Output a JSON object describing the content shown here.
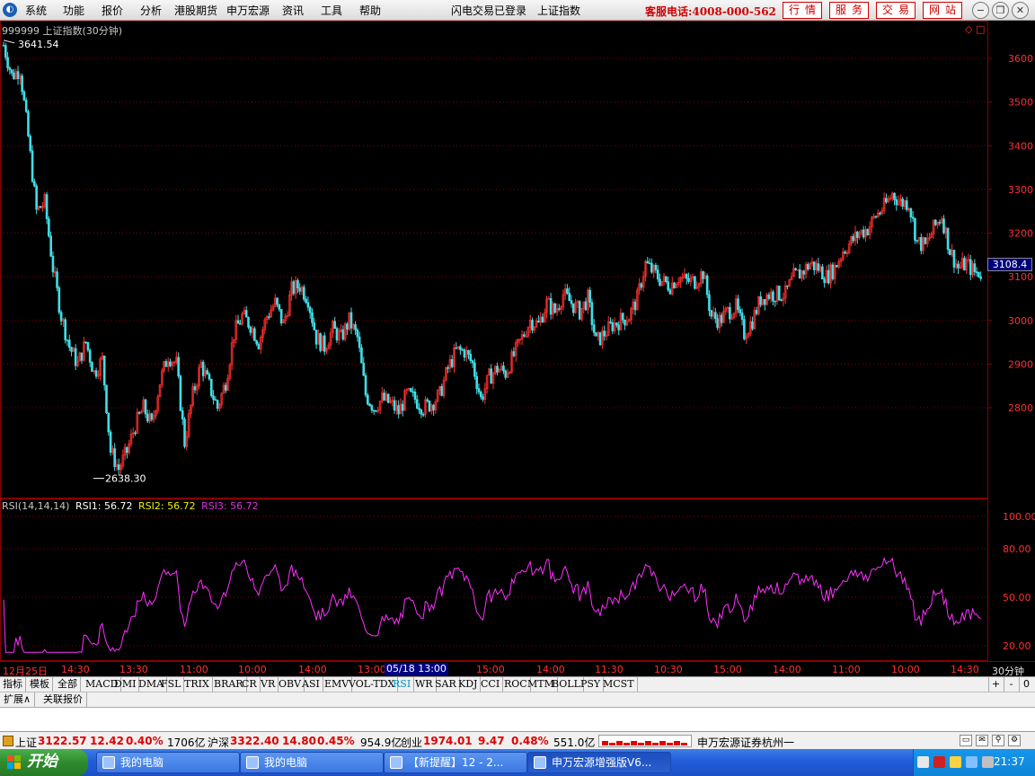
{
  "menubar": {
    "logo": "◐",
    "items": [
      "系统",
      "功能",
      "报价",
      "分析",
      "港股期货",
      "申万宏源",
      "资讯",
      "工具",
      "帮助"
    ],
    "status": "闪电交易已登录",
    "index_name": "上证指数",
    "hotline": "客服电话:4008-000-562",
    "buttons": [
      "行情",
      "服务",
      "交易",
      "网站"
    ],
    "window_buttons": [
      "−",
      "❐",
      "✕"
    ]
  },
  "chart": {
    "title": "999999 上证指数(30分钟)",
    "panel_icons": "◇ □",
    "high_marker": "3641.54",
    "low_marker": "2638.30",
    "cursor_price": "3108.4",
    "price_axis": [
      "3600",
      "3500",
      "3400",
      "3300",
      "3200",
      "3100",
      "3000",
      "2900",
      "2800"
    ],
    "rsi_axis": [
      "100.00",
      "80.00",
      "50.00",
      "20.00"
    ],
    "colors": {
      "up": "#ff3030",
      "down": "#40e0e8",
      "rsi": "#ff30ff",
      "grid": "#880000"
    }
  },
  "chart_data": [
    {
      "type": "line",
      "title": "999999 上证指数(30分钟)",
      "ylim": [
        2620,
        3680
      ],
      "high": 3641.54,
      "low": 2638.3,
      "last": 3108.4,
      "close": [
        3630,
        3560,
        3575,
        3420,
        3250,
        3270,
        3120,
        3010,
        2940,
        2900,
        2950,
        2880,
        2910,
        2700,
        2660,
        2700,
        2760,
        2800,
        2760,
        2860,
        2920,
        2900,
        2720,
        2830,
        2900,
        2850,
        2800,
        2860,
        2970,
        3010,
        2990,
        2950,
        3010,
        3040,
        2990,
        3070,
        3080,
        3050,
        2960,
        2940,
        2980,
        2960,
        3000,
        2960,
        2830,
        2800,
        2820,
        2810,
        2790,
        2830,
        2820,
        2800,
        2810,
        2830,
        2890,
        2930,
        2930,
        2900,
        2820,
        2870,
        2890,
        2880,
        2920,
        2960,
        3000,
        2990,
        3040,
        3020,
        3060,
        3040,
        3020,
        3050,
        2950,
        2970,
        2990,
        3000,
        3010,
        3050,
        3130,
        3110,
        3090,
        3080,
        3100,
        3090,
        3090,
        3110,
        3010,
        3000,
        3020,
        3030,
        2970,
        3000,
        3050,
        3060,
        3060,
        3060,
        3100,
        3110,
        3130,
        3120,
        3100,
        3120,
        3160,
        3180,
        3200,
        3210,
        3240,
        3260,
        3290,
        3270,
        3270,
        3180,
        3170,
        3210,
        3240,
        3160,
        3120,
        3130,
        3110,
        3108
      ]
    },
    {
      "type": "line",
      "title": "RSI(14,14,14)",
      "series": [
        {
          "name": "RSI1",
          "last": 56.72
        },
        {
          "name": "RSI2",
          "last": 56.72
        },
        {
          "name": "RSI3",
          "last": 56.72
        }
      ],
      "ylim": [
        20,
        100
      ]
    }
  ],
  "rsi": {
    "label": "RSI(14,14,14)",
    "rsi1": "RSI1: 56.72",
    "rsi2": "RSI2: 56.72",
    "rsi3": "RSI3: 56.72"
  },
  "timeaxis": {
    "ticks": [
      "12月25日",
      "14:30",
      "13:30",
      "11:00",
      "10:00",
      "14:00",
      "13:00",
      "15:00",
      "14:00",
      "11:30",
      "10:30",
      "15:00",
      "14:00",
      "11:00",
      "10:00",
      "14:30"
    ],
    "cursor": "05/18 13:00",
    "period": "30分钟"
  },
  "tabs": {
    "items": [
      "指标",
      "模板",
      "全部",
      "MACD",
      "DMI",
      "DMA",
      "FSL",
      "TRIX",
      "BRAR",
      "CR",
      "VR",
      "OBV",
      "ASI",
      "EMV",
      "VOL-TDX",
      "RSI",
      "WR",
      "SAR",
      "KDJ",
      "CCI",
      "ROC",
      "MTM",
      "BOLL",
      "PSY",
      "MCST"
    ],
    "active": "RSI",
    "nav": [
      "+",
      "-",
      "0"
    ]
  },
  "expand": {
    "items": [
      "扩展∧",
      "关联报价"
    ]
  },
  "status": {
    "sh_label": "上证",
    "sh_price": "3122.57",
    "sh_change": "12.42",
    "sh_pct": "0.40%",
    "sh_amount": "1706亿",
    "hs_label": "沪深",
    "hs_price": "3322.40",
    "hs_change": "14.80",
    "hs_pct": "0.45%",
    "hs_amount": "954.9亿",
    "cy_label": "创业",
    "cy_price": "1974.01",
    "cy_change": "9.47",
    "cy_pct": "0.48%",
    "cy_amount": "551.0亿",
    "broker": "申万宏源证券杭州一"
  },
  "taskbar": {
    "start": "开始",
    "tasks": [
      "我的电脑",
      "我的电脑",
      "【新提醒】12 - 2...",
      "申万宏源增强版V6..."
    ],
    "clock": "21:37"
  }
}
